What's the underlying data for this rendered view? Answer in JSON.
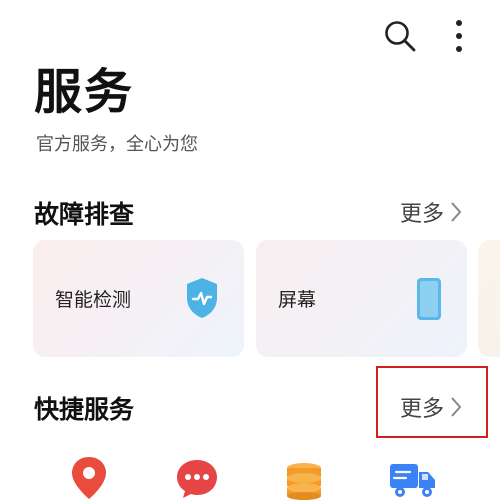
{
  "header": {
    "title": "服务",
    "subtitle": "官方服务，全心为您",
    "search_icon": "search-icon",
    "more_icon": "more-vertical-icon"
  },
  "troubleshooting": {
    "title": "故障排查",
    "more_label": "更多",
    "cards": [
      {
        "label": "智能检测",
        "icon": "shield-check-icon"
      },
      {
        "label": "屏幕",
        "icon": "phone-screen-icon"
      }
    ]
  },
  "quick_services": {
    "title": "快捷服务",
    "more_label": "更多",
    "icons": [
      "location-pin-icon",
      "chat-bubble-icon",
      "coins-icon",
      "delivery-truck-icon"
    ]
  },
  "colors": {
    "highlight": "#d02020",
    "shield": "#4db2e6",
    "phone": "#5ab8ea",
    "pin": "#e94b3c",
    "chat": "#e54545",
    "coins": "#f39a2a",
    "truck": "#3b82f6"
  }
}
